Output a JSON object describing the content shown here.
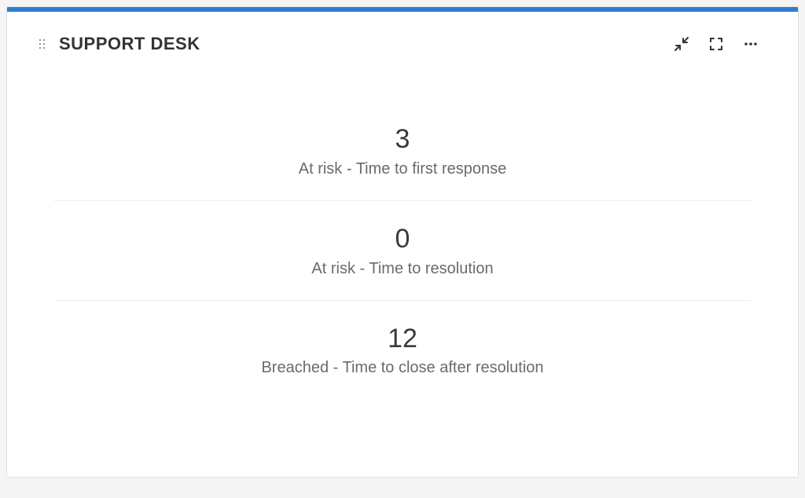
{
  "header": {
    "title": "SUPPORT DESK"
  },
  "metrics": [
    {
      "value": "3",
      "label": "At risk - Time to first response"
    },
    {
      "value": "0",
      "label": "At risk - Time to resolution"
    },
    {
      "value": "12",
      "label": "Breached - Time to close after resolution"
    }
  ],
  "colors": {
    "accent": "#2d7dd2"
  }
}
